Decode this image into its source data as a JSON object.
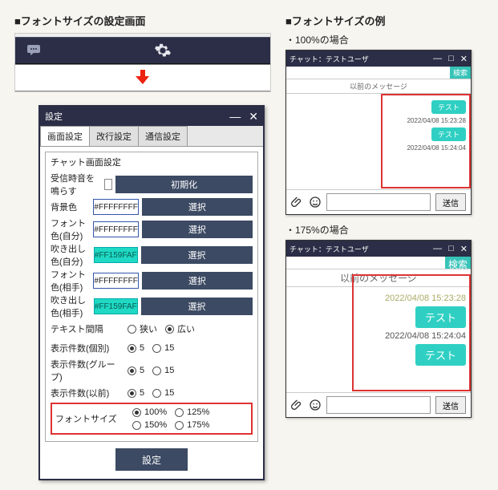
{
  "headings": {
    "left": "■フォントサイズの設定画面",
    "right": "■フォントサイズの例",
    "case100": "・100%の場合",
    "case175": "・175%の場合"
  },
  "settings_dialog": {
    "title": "設定",
    "tabs": [
      "画面設定",
      "改行設定",
      "通信設定"
    ],
    "group_title": "チャット画面設定",
    "sound_label": "受信時音を鳴らす",
    "init_btn": "初期化",
    "rows": {
      "bgcolor": {
        "label": "背景色",
        "value": "#FFFFFFFF"
      },
      "fontcolor_self": {
        "label": "フォント色(自分)",
        "value": "#FFFFFFFF"
      },
      "bubble_self": {
        "label": "吹き出し色(自分)",
        "value": "#FF159FAF"
      },
      "fontcolor_other": {
        "label": "フォント色(相手)",
        "value": "#FFFFFFFF"
      },
      "bubble_other": {
        "label": "吹き出し色(相手)",
        "value": "#FF159FAF"
      }
    },
    "select_btn": "選択",
    "text_spacing": {
      "label": "テキスト間隔",
      "options": [
        "狭い",
        "広い"
      ],
      "selected": 1
    },
    "count_indiv": {
      "label": "表示件数(個別)",
      "options": [
        "5",
        "15"
      ],
      "selected": 0
    },
    "count_group": {
      "label": "表示件数(グループ)",
      "options": [
        "5",
        "15"
      ],
      "selected": 0
    },
    "count_prev": {
      "label": "表示件数(以前)",
      "options": [
        "5",
        "15"
      ],
      "selected": 0
    },
    "font_size": {
      "label": "フォントサイズ",
      "options": [
        "100%",
        "125%",
        "150%",
        "175%"
      ],
      "selected": 0
    },
    "apply_btn": "設定"
  },
  "chat": {
    "title": "チャット：テストユーザ",
    "search_label": "検索",
    "divider": "以前のメッセージ",
    "send_btn": "送信",
    "bubble_text": "テスト",
    "ts1": "2022/04/08 15:23:28",
    "ts2": "2022/04/08 15:24:04",
    "ts2_cut": "2022/04/08 15:23:28"
  }
}
